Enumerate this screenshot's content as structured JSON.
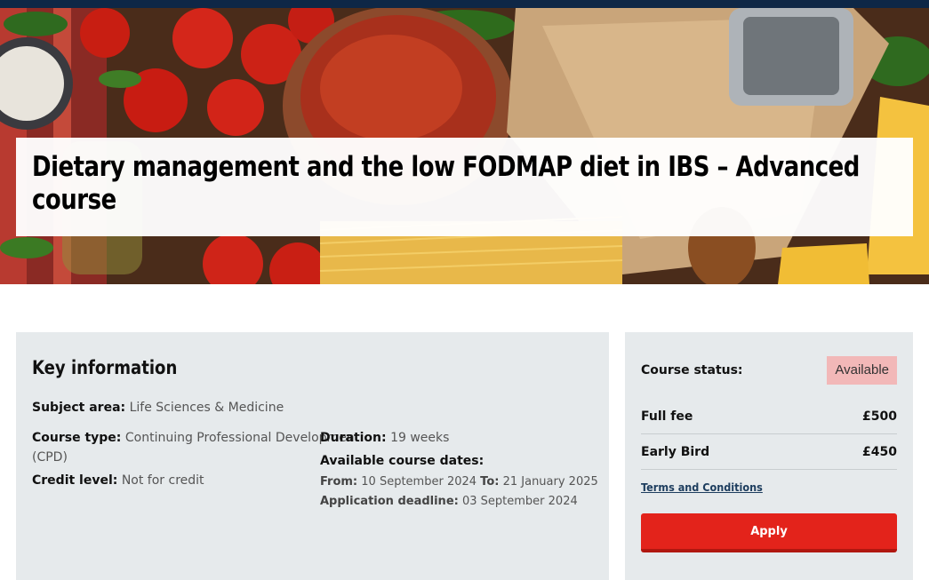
{
  "hero": {
    "title": "Dietary management and the low FODMAP diet in IBS – Advanced course"
  },
  "key_info": {
    "heading": "Key information",
    "subject_area_label": "Subject area:",
    "subject_area_value": "Life Sciences & Medicine",
    "course_type_label": "Course type:",
    "course_type_value_line1": "Continuing Professional Development",
    "course_type_value_line2": "(CPD)",
    "credit_level_label": "Credit level:",
    "credit_level_value": "Not for credit",
    "duration_label": "Duration:",
    "duration_value": "19 weeks",
    "dates_heading": "Available course dates:",
    "from_label": "From:",
    "from_value": "10 September 2024",
    "to_label": "To:",
    "to_value": "21 January 2025",
    "deadline_label": "Application deadline:",
    "deadline_value": "03 September 2024"
  },
  "sidebar": {
    "status_label": "Course status:",
    "status_value": "Available",
    "fees": [
      {
        "label": "Full fee",
        "amount": "£500"
      },
      {
        "label": "Early Bird",
        "amount": "£450"
      }
    ],
    "terms_link": "Terms and Conditions",
    "apply_label": "Apply"
  },
  "colors": {
    "accent": "#e3231b",
    "status_badge": "#f2b8b8",
    "panel_bg": "#e6eaec",
    "top_bar": "#0e2746",
    "link": "#1d3d5e"
  }
}
